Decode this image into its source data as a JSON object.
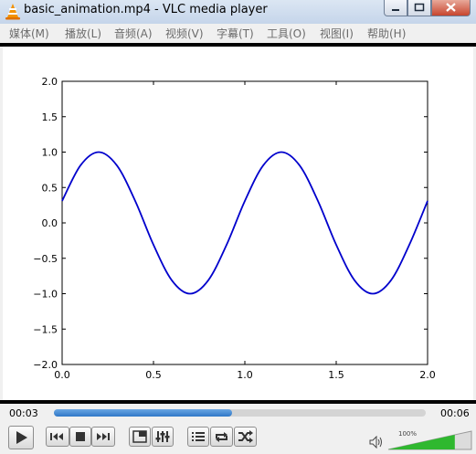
{
  "window": {
    "title": "basic_animation.mp4 - VLC media player",
    "accent": "#c5d5ea"
  },
  "menu": [
    {
      "label": "媒体(M)"
    },
    {
      "label": "播放(L)"
    },
    {
      "label": "音频(A)"
    },
    {
      "label": "视频(V)"
    },
    {
      "label": "字幕(T)"
    },
    {
      "label": "工具(O)"
    },
    {
      "label": "视图(I)"
    },
    {
      "label": "帮助(H)"
    }
  ],
  "chart_data": {
    "type": "line",
    "title": "",
    "xlabel": "",
    "ylabel": "",
    "xlim": [
      0.0,
      2.0
    ],
    "ylim": [
      -2.0,
      2.0
    ],
    "x_ticks": [
      "0.0",
      "0.5",
      "1.0",
      "1.5",
      "2.0"
    ],
    "y_ticks": [
      "2.0",
      "1.5",
      "1.0",
      "0.5",
      "0.0",
      "−0.5",
      "−1.0",
      "−1.5",
      "−2.0"
    ],
    "grid": false,
    "line_color": "#0000cc",
    "series": [
      {
        "x": [
          0.0,
          0.1,
          0.2,
          0.3,
          0.4,
          0.5,
          0.6,
          0.7,
          0.8,
          0.9,
          1.0,
          1.1,
          1.2,
          1.3,
          1.4,
          1.5,
          1.6,
          1.7,
          1.8,
          1.9,
          2.0
        ],
        "y": [
          0.31,
          0.81,
          1.0,
          0.81,
          0.31,
          -0.31,
          -0.81,
          -1.0,
          -0.81,
          -0.31,
          0.31,
          0.81,
          1.0,
          0.81,
          0.31,
          -0.31,
          -0.81,
          -1.0,
          -0.81,
          -0.31,
          0.31
        ]
      }
    ]
  },
  "controls": {
    "elapsed": "00:03",
    "total": "00:06",
    "progress_fraction": 0.48,
    "volume_label": "100%",
    "volume_fraction": 0.8,
    "seek_color": "#2f78c7",
    "volume_color": "#2fb82f"
  }
}
